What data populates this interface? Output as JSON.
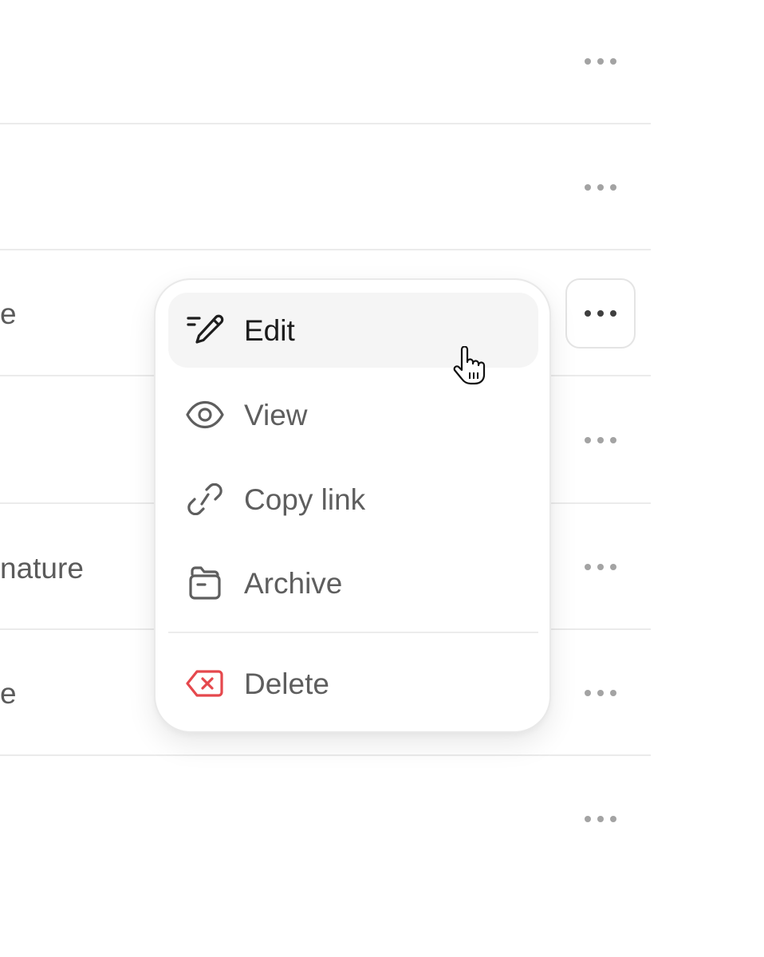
{
  "rows": [
    {
      "text": ""
    },
    {
      "text": ""
    },
    {
      "text": "e"
    },
    {
      "text": ""
    },
    {
      "text": "nature"
    },
    {
      "text": "e"
    },
    {
      "text": ""
    }
  ],
  "more_button": {
    "label": "More actions",
    "icon": "more-horizontal-icon"
  },
  "menu": {
    "items": [
      {
        "label": "Edit",
        "icon": "edit-pen-icon"
      },
      {
        "label": "View",
        "icon": "eye-icon"
      },
      {
        "label": "Copy link",
        "icon": "link-icon"
      },
      {
        "label": "Archive",
        "icon": "archive-folder-icon"
      },
      {
        "label": "Delete",
        "icon": "delete-icon"
      }
    ]
  },
  "colors": {
    "text": "#5e5e5e",
    "hover_background": "#f5f5f5",
    "danger": "#e5484d",
    "border": "#e9e9e9"
  },
  "cursor": "hand-pointer"
}
